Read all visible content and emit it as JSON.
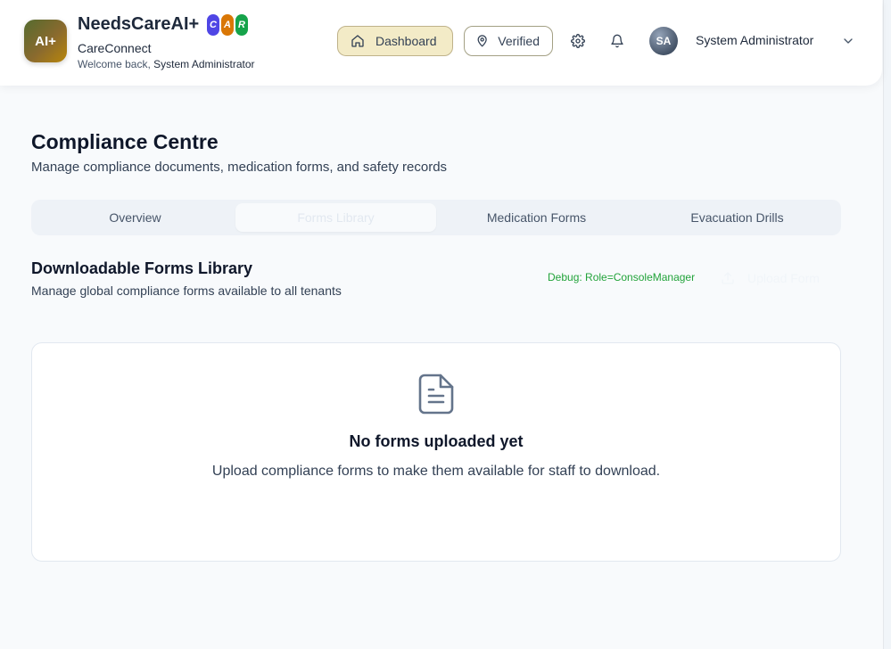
{
  "header": {
    "logo_text": "AI+",
    "brand_name": "NeedsCareAI+",
    "badges": [
      {
        "letter": "C",
        "color": "#4f46e5"
      },
      {
        "letter": "A",
        "color": "#d97706"
      },
      {
        "letter": "R",
        "color": "#16a34a"
      }
    ],
    "brand_sub": "CareConnect",
    "welcome_prefix": "Welcome back, ",
    "welcome_user": "System Administrator",
    "nav": {
      "dashboard_label": "Dashboard",
      "verified_label": "Verified"
    },
    "avatar_initials": "SA",
    "user_name": "System Administrator"
  },
  "page": {
    "title": "Compliance Centre",
    "subtitle": "Manage compliance documents, medication forms, and safety records"
  },
  "tabs": [
    {
      "label": "Overview",
      "active": false
    },
    {
      "label": "Forms Library",
      "active": true
    },
    {
      "label": "Medication Forms",
      "active": false
    },
    {
      "label": "Evacuation Drills",
      "active": false
    }
  ],
  "section": {
    "title": "Downloadable Forms Library",
    "subtitle": "Manage global compliance forms available to all tenants",
    "debug_text": "Debug: Role=ConsoleManager",
    "upload_label": "Upload Form"
  },
  "empty_state": {
    "title": "No forms uploaded yet",
    "description": "Upload compliance forms to make them available for staff to download."
  },
  "colors": {
    "accent": "#f3ebc7",
    "debug_green": "#22a33a"
  }
}
